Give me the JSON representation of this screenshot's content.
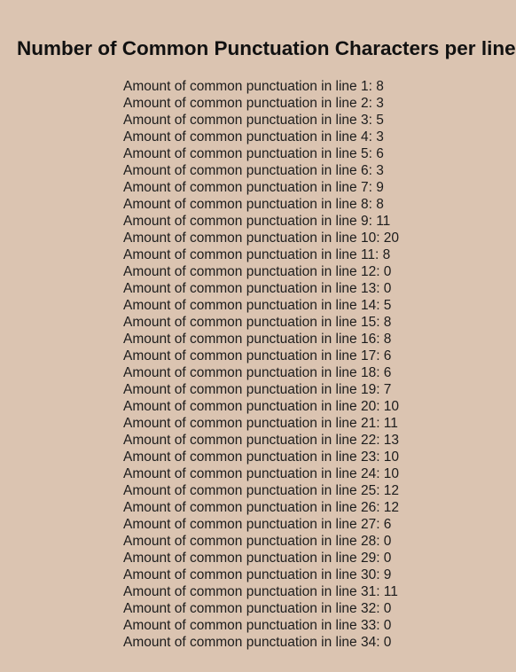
{
  "title": "Number of Common Punctuation Characters per line",
  "lines": [
    "Amount of common punctuation in line 1: 8",
    "Amount of common punctuation in line 2: 3",
    "Amount of common punctuation in line 3: 5",
    "Amount of common punctuation in line 4: 3",
    "Amount of common punctuation in line 5: 6",
    "Amount of common punctuation in line 6: 3",
    "Amount of common punctuation in line 7: 9",
    "Amount of common punctuation in line 8: 8",
    "Amount of common punctuation in line 9: 11",
    "Amount of common punctuation in line 10: 20",
    "Amount of common punctuation in line 11: 8",
    "Amount of common punctuation in line 12: 0",
    "Amount of common punctuation in line 13: 0",
    "Amount of common punctuation in line 14: 5",
    "Amount of common punctuation in line 15: 8",
    "Amount of common punctuation in line 16: 8",
    "Amount of common punctuation in line 17: 6",
    "Amount of common punctuation in line 18: 6",
    "Amount of common punctuation in line 19: 7",
    "Amount of common punctuation in line 20: 10",
    "Amount of common punctuation in line 21: 11",
    "Amount of common punctuation in line 22: 13",
    "Amount of common punctuation in line 23: 10",
    "Amount of common punctuation in line 24: 10",
    "Amount of common punctuation in line 25: 12",
    "Amount of common punctuation in line 26: 12",
    "Amount of common punctuation in line 27: 6",
    "Amount of common punctuation in line 28: 0",
    "Amount of common punctuation in line 29: 0",
    "Amount of common punctuation in line 30: 9",
    "Amount of common punctuation in line 31: 11",
    "Amount of common punctuation in line 32: 0",
    "Amount of common punctuation in line 33: 0",
    "Amount of common punctuation in line 34: 0"
  ]
}
